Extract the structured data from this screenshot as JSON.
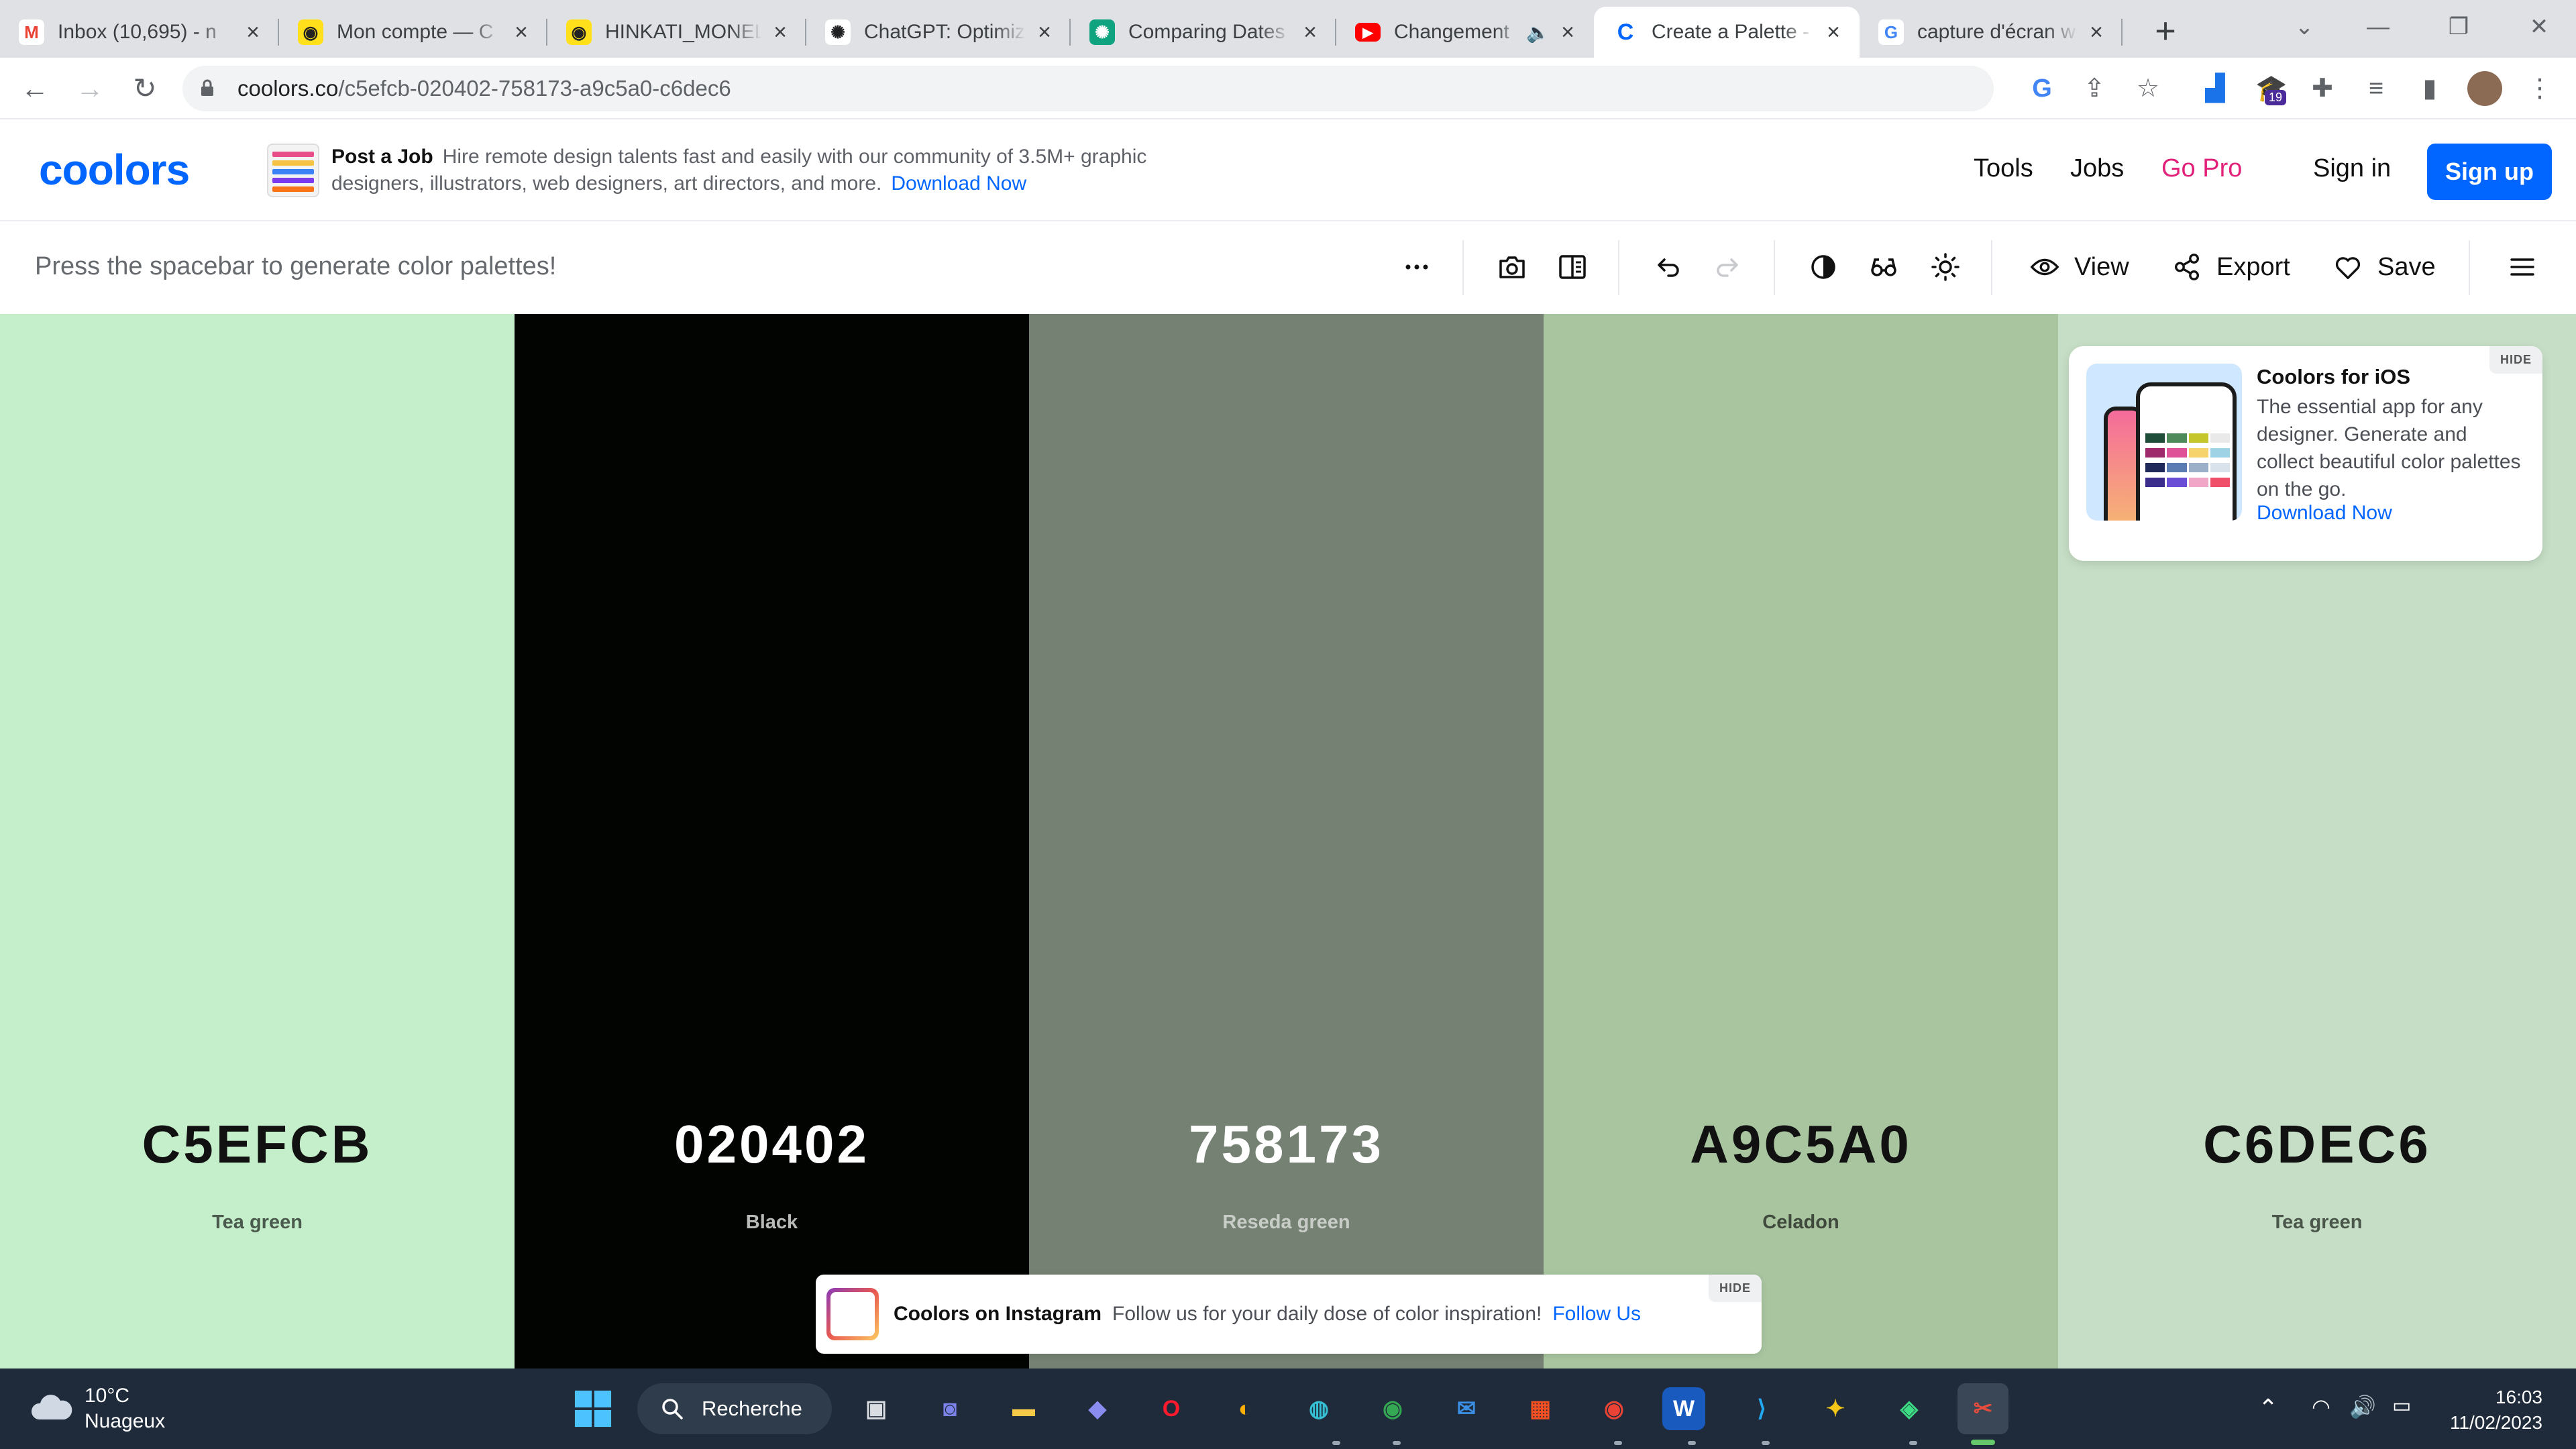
{
  "browser": {
    "tabs": [
      {
        "title": "Inbox (10,695) - n",
        "icon": "gmail-icon",
        "color": "#ea4335"
      },
      {
        "title": "Mon compte — C",
        "icon": "mailchimp-icon",
        "color": "#ffe01b"
      },
      {
        "title": "HINKATI_MONEL",
        "icon": "mailchimp-icon",
        "color": "#ffe01b"
      },
      {
        "title": "ChatGPT: Optimiz",
        "icon": "openai-icon",
        "color": "#202123"
      },
      {
        "title": "Comparing Dates",
        "icon": "openai-icon",
        "color": "#10a37f"
      },
      {
        "title": "Changement",
        "icon": "youtube-icon",
        "color": "#ff0000",
        "muted": true
      },
      {
        "title": "Create a Palette -",
        "icon": "coolors-icon",
        "color": "#0066ff",
        "active": true
      },
      {
        "title": "capture d'écran w",
        "icon": "google-icon",
        "color": "#4285f4"
      }
    ],
    "url": {
      "host": "coolors.co",
      "path": "/c5efcb-020402-758173-a9c5a0-c6dec6"
    },
    "extension_badge": "19"
  },
  "header": {
    "logo": "coolors",
    "ad": {
      "title": "Post a Job",
      "text": "Hire remote design talents fast and easily with our community of 3.5M+ graphic designers, illustrators, web designers, art directors, and more.",
      "link": "Download Now"
    },
    "nav": {
      "tools": "Tools",
      "jobs": "Jobs",
      "go_pro": "Go Pro",
      "sign_in": "Sign in",
      "sign_up": "Sign up"
    }
  },
  "toolbar": {
    "hint": "Press the spacebar to generate color palettes!",
    "view": "View",
    "export": "Export",
    "save": "Save"
  },
  "palette": [
    {
      "hex": "C5EFCB",
      "name": "Tea green",
      "color": "#c5efcb",
      "text_color": "#111111",
      "name_color": "#4a5a4c"
    },
    {
      "hex": "020402",
      "name": "Black",
      "color": "#020402",
      "text_color": "#ffffff",
      "name_color": "#b8bbb8"
    },
    {
      "hex": "758173",
      "name": "Reseda green",
      "color": "#758173",
      "text_color": "#ffffff",
      "name_color": "#c8cec7"
    },
    {
      "hex": "A9C5A0",
      "name": "Celadon",
      "color": "#a9c5a0",
      "text_color": "#111111",
      "name_color": "#3f4a3c"
    },
    {
      "hex": "C6DEC6",
      "name": "Tea green",
      "color": "#c6dec6",
      "text_color": "#111111",
      "name_color": "#4a564a"
    }
  ],
  "ios_promo": {
    "title": "Coolors for iOS",
    "body": "The essential app for any designer. Generate and collect beautiful color palettes on the go.",
    "link": "Download Now",
    "hide": "HIDE"
  },
  "instagram_promo": {
    "title": "Coolors on Instagram",
    "body": "Follow us for your daily dose of color inspiration!",
    "link": "Follow Us",
    "hide": "HIDE"
  },
  "taskbar": {
    "weather": {
      "temp": "10°C",
      "desc": "Nuageux"
    },
    "search": "Recherche",
    "time": "16:03",
    "date": "11/02/2023"
  }
}
